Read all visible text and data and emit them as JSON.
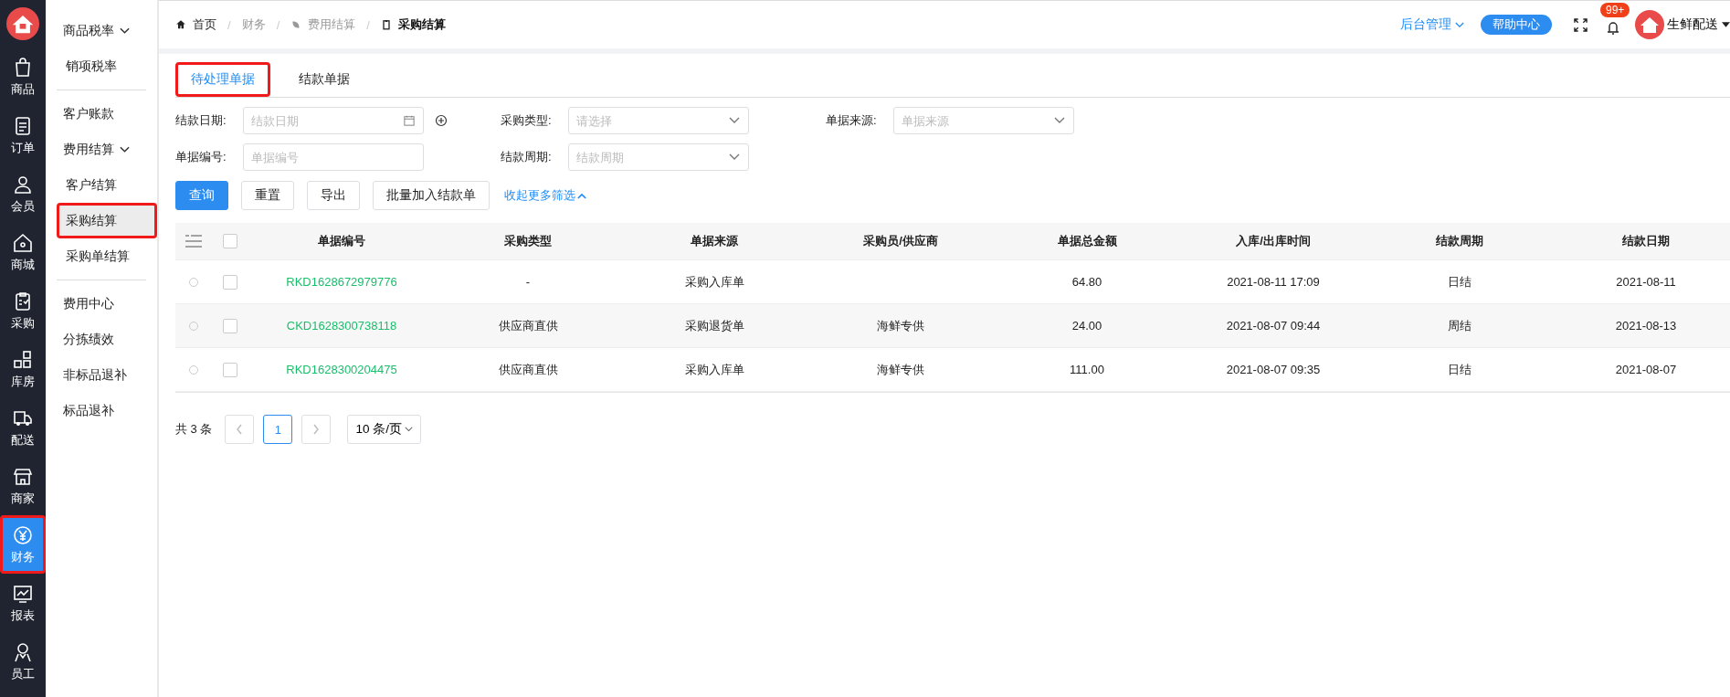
{
  "rail": {
    "items": [
      {
        "label": "商品",
        "selected": false,
        "highlighted": false
      },
      {
        "label": "订单",
        "selected": false,
        "highlighted": false
      },
      {
        "label": "会员",
        "selected": false,
        "highlighted": false
      },
      {
        "label": "商城",
        "selected": false,
        "highlighted": false
      },
      {
        "label": "采购",
        "selected": false,
        "highlighted": false
      },
      {
        "label": "库房",
        "selected": false,
        "highlighted": false
      },
      {
        "label": "配送",
        "selected": false,
        "highlighted": false
      },
      {
        "label": "商家",
        "selected": false,
        "highlighted": false
      },
      {
        "label": "财务",
        "selected": true,
        "highlighted": true
      },
      {
        "label": "报表",
        "selected": false,
        "highlighted": false
      },
      {
        "label": "员工",
        "selected": false,
        "highlighted": false
      }
    ]
  },
  "subnav": {
    "sections": [
      {
        "items": [
          {
            "kind": "group",
            "label": "商品税率",
            "expanded": true,
            "children": [
              {
                "label": "销项税率",
                "selected": false,
                "highlighted": false
              }
            ]
          }
        ]
      },
      {
        "items": [
          {
            "kind": "link",
            "label": "客户账款",
            "selected": false,
            "highlighted": false
          },
          {
            "kind": "group",
            "label": "费用结算",
            "expanded": true,
            "children": [
              {
                "label": "客户结算",
                "selected": false,
                "highlighted": false
              },
              {
                "label": "采购结算",
                "selected": true,
                "highlighted": true
              },
              {
                "label": "采购单结算",
                "selected": false,
                "highlighted": false
              }
            ]
          }
        ]
      },
      {
        "items": [
          {
            "kind": "link",
            "label": "费用中心",
            "selected": false,
            "highlighted": false
          },
          {
            "kind": "link",
            "label": "分拣绩效",
            "selected": false,
            "highlighted": false
          },
          {
            "kind": "link",
            "label": "非标品退补",
            "selected": false,
            "highlighted": false
          },
          {
            "kind": "link",
            "label": "标品退补",
            "selected": false,
            "highlighted": false
          }
        ]
      }
    ]
  },
  "breadcrumb": {
    "separator": "/",
    "items": [
      {
        "label": "首页",
        "current": false
      },
      {
        "label": "财务",
        "current": false
      },
      {
        "label": "费用结算",
        "current": false
      },
      {
        "label": "采购结算",
        "current": true
      }
    ]
  },
  "header": {
    "menu": "后台管理",
    "help_button": "帮助中心",
    "notification_badge": "99+",
    "user": "生鲜配送"
  },
  "tabs": [
    {
      "label": "待处理单据",
      "selected": true,
      "highlighted": true
    },
    {
      "label": "结款单据",
      "selected": false,
      "highlighted": false
    }
  ],
  "filters": [
    {
      "kind": "date",
      "label": "结款日期:",
      "placeholder": "结款日期"
    },
    {
      "kind": "select",
      "label": "采购类型:",
      "placeholder": "请选择"
    },
    {
      "kind": "select",
      "label": "单据来源:",
      "placeholder": "单据来源"
    },
    {
      "kind": "text",
      "label": "单据编号:",
      "placeholder": "单据编号"
    },
    {
      "kind": "select",
      "label": "结款周期:",
      "placeholder": "结款周期"
    }
  ],
  "actions": [
    {
      "kind": "primary",
      "label": "查询"
    },
    {
      "kind": "default",
      "label": "重置"
    },
    {
      "kind": "default",
      "label": "导出"
    },
    {
      "kind": "default",
      "label": "批量加入结款单"
    },
    {
      "kind": "link",
      "label": "收起更多筛选"
    }
  ],
  "table": {
    "all_checked": false,
    "columns": [
      "单据编号",
      "采购类型",
      "单据来源",
      "采购员/供应商",
      "单据总金额",
      "入库/出库时间",
      "结款周期",
      "结款日期"
    ],
    "rows": [
      {
        "selected": false,
        "checked": false,
        "cells": [
          "RKD1628672979776",
          "-",
          "采购入库单",
          "",
          "64.80",
          "2021-08-11 17:09",
          "日结",
          "2021-08-11"
        ]
      },
      {
        "selected": false,
        "checked": false,
        "cells": [
          "CKD1628300738118",
          "供应商直供",
          "采购退货单",
          "海鲜专供",
          "24.00",
          "2021-08-07 09:44",
          "周结",
          "2021-08-13"
        ]
      },
      {
        "selected": false,
        "checked": false,
        "cells": [
          "RKD1628300204475",
          "供应商直供",
          "采购入库单",
          "海鲜专供",
          "111.00",
          "2021-08-07 09:35",
          "日结",
          "2021-08-07"
        ]
      }
    ]
  },
  "pagination": {
    "total": "共 3 条",
    "pages": [
      {
        "label": "1",
        "selected": true
      }
    ],
    "page_size": "10 条/页"
  }
}
